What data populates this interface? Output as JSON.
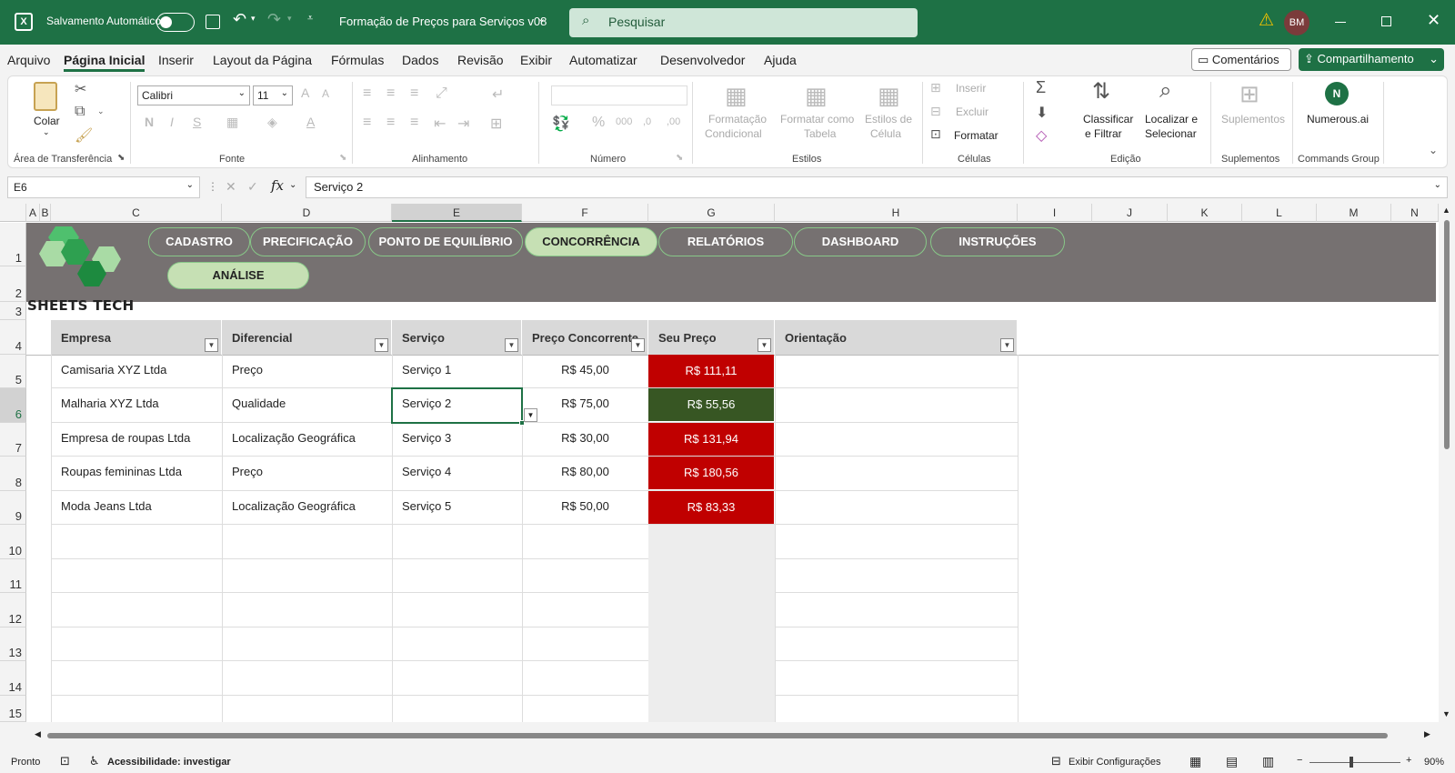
{
  "titlebar": {
    "autosave_label": "Salvamento Automático",
    "doc_title": "Formação de Preços para Serviços  v08",
    "search_placeholder": "Pesquisar",
    "avatar_initials": "BM"
  },
  "menu": [
    "Arquivo",
    "Página Inicial",
    "Inserir",
    "Layout da Página",
    "Fórmulas",
    "Dados",
    "Revisão",
    "Exibir",
    "Automatizar",
    "Desenvolvedor",
    "Ajuda"
  ],
  "menu_active": "Página Inicial",
  "actions": {
    "comments": "Comentários",
    "share": "Compartilhamento"
  },
  "ribbon": {
    "clipboard": {
      "paste": "Colar",
      "label": "Área de Transferência"
    },
    "font": {
      "name": "Calibri",
      "size": "11",
      "label": "Fonte"
    },
    "alignment": {
      "label": "Alinhamento"
    },
    "number": {
      "label": "Número"
    },
    "styles": {
      "cond": [
        "Formatação",
        "Condicional"
      ],
      "table": [
        "Formatar como",
        "Tabela"
      ],
      "cell": [
        "Estilos de",
        "Célula"
      ],
      "label": "Estilos"
    },
    "cells": {
      "insert": "Inserir",
      "delete": "Excluir",
      "format": "Formatar",
      "label": "Células"
    },
    "editing": {
      "sort": [
        "Classificar",
        "e Filtrar"
      ],
      "find": [
        "Localizar e",
        "Selecionar"
      ],
      "label": "Edição"
    },
    "addins": {
      "btn": "Suplementos",
      "label": "Suplementos"
    },
    "commands": {
      "btn": "Numerous.ai",
      "label": "Commands Group"
    }
  },
  "formula": {
    "namebox": "E6",
    "content": "Serviço 2"
  },
  "columns": [
    "A",
    "B",
    "C",
    "D",
    "E",
    "F",
    "G",
    "H",
    "I",
    "J",
    "K",
    "L",
    "M",
    "N"
  ],
  "rows": [
    "1",
    "2",
    "3",
    "4",
    "5",
    "6",
    "7",
    "8",
    "9",
    "10",
    "11",
    "12",
    "13",
    "14",
    "15"
  ],
  "nav": [
    "CADASTRO",
    "PRECIFICAÇÃO",
    "PONTO DE EQUILÍBRIO",
    "CONCORRÊNCIA",
    "RELATÓRIOS",
    "DASHBOARD",
    "INSTRUÇÕES",
    "ANÁLISE"
  ],
  "brand": "SHEETS TECH",
  "table": {
    "headers": [
      "Empresa",
      "Diferencial",
      "Serviço",
      "Preço Concorrente",
      "Seu Preço",
      "Orientação"
    ],
    "rows": [
      [
        "Camisaria XYZ Ltda",
        "Preço",
        "Serviço 1",
        "R$ 45,00",
        "R$ 111,11",
        ""
      ],
      [
        "Malharia XYZ Ltda",
        "Qualidade",
        "Serviço 2",
        "R$ 75,00",
        "R$ 55,56",
        ""
      ],
      [
        "Empresa de roupas Ltda",
        "Localização Geográfica",
        "Serviço 3",
        "R$ 30,00",
        "R$ 131,94",
        ""
      ],
      [
        "Roupas femininas Ltda",
        "Preço",
        "Serviço 4",
        "R$ 80,00",
        "R$ 180,56",
        ""
      ],
      [
        "Moda Jeans Ltda",
        "Localização Geográfica",
        "Serviço 5",
        "R$ 50,00",
        "R$ 83,33",
        ""
      ]
    ],
    "price_status": [
      "red",
      "green",
      "red",
      "red",
      "red"
    ]
  },
  "colors": {
    "brand_green": "#1e7145",
    "price_red": "#c00000",
    "price_green": "#375623",
    "banner_gray": "#767171",
    "nav_active": "#c6e0b4"
  },
  "status": {
    "ready": "Pronto",
    "accessibility": "Acessibilidade: investigar",
    "display_settings": "Exibir Configurações",
    "zoom": "90%"
  }
}
